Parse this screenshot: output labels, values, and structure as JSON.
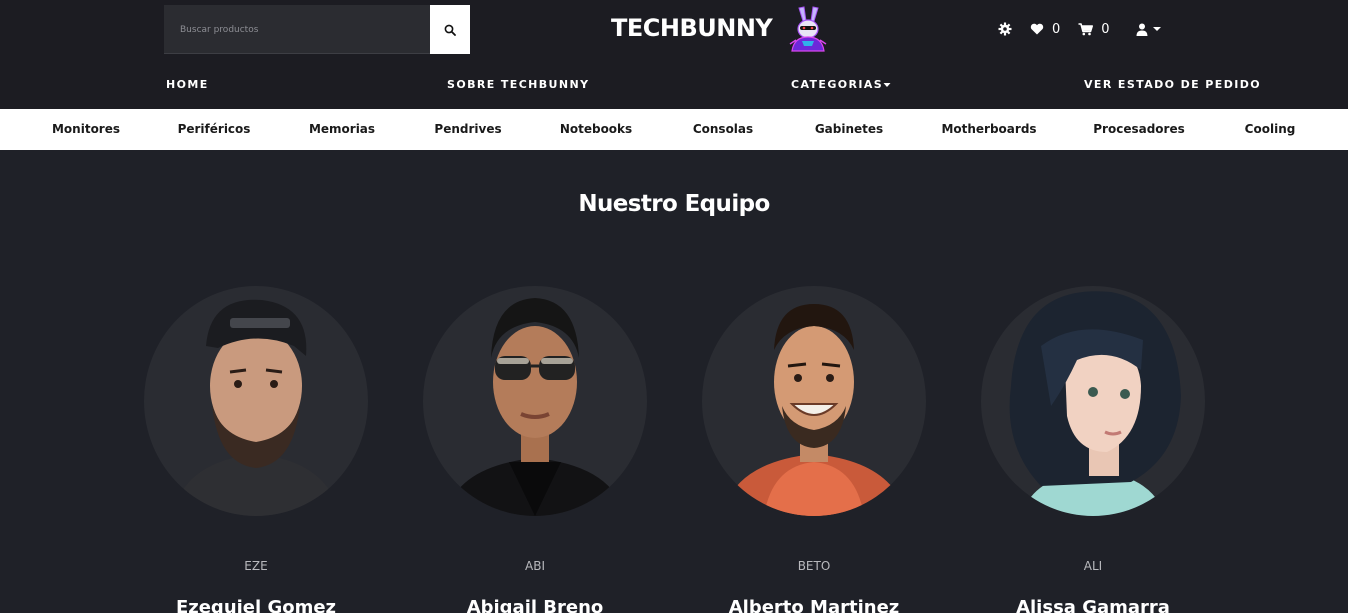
{
  "header": {
    "search_placeholder": "Buscar productos",
    "logo_text": "TECHBUNNY",
    "favorites_count": "0",
    "cart_count": "0"
  },
  "main_nav": {
    "home": "HOME",
    "about": "SOBRE TECHBUNNY",
    "categories": "CATEGORIAS",
    "order_status": "VER ESTADO DE PEDIDO"
  },
  "categories": [
    "Monitores",
    "Periféricos",
    "Memorias",
    "Pendrives",
    "Notebooks",
    "Consolas",
    "Gabinetes",
    "Motherboards",
    "Procesadores",
    "Cooling"
  ],
  "team": {
    "title": "Nuestro Equipo",
    "members": [
      {
        "nick": "EZE",
        "name": "Ezequiel Gomez"
      },
      {
        "nick": "ABI",
        "name": "Abigail Breno"
      },
      {
        "nick": "BETO",
        "name": "Alberto Martinez"
      },
      {
        "nick": "ALI",
        "name": "Alissa Gamarra"
      }
    ]
  },
  "colors": {
    "page_bg": "#1f2128",
    "header_bg": "#1c1c22",
    "category_bar_bg": "#ffffff",
    "logo_accent": "#d946ef"
  },
  "icons": [
    "search-icon",
    "bunny-logo-icon",
    "gear-icon",
    "heart-icon",
    "cart-icon",
    "user-icon",
    "caret-down-icon"
  ]
}
